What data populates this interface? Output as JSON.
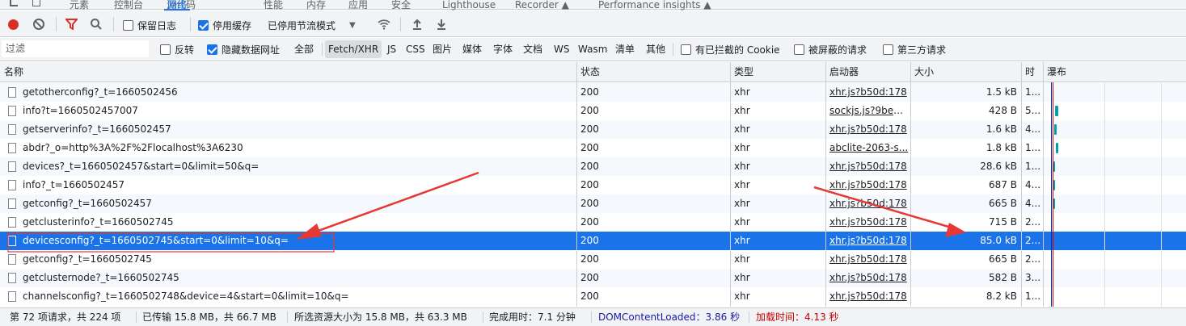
{
  "tabs": [
    "元素",
    "控制台",
    "源代码",
    "网络",
    "性能",
    "内存",
    "应用",
    "安全",
    "Lighthouse",
    "Recorder ▲",
    "Performance insights ▲"
  ],
  "toolbar": {
    "preserve_log": "保留日志",
    "disable_cache": "停用缓存",
    "throttle": "已停用节流模式"
  },
  "filter": {
    "placeholder": "过滤",
    "invert": "反转",
    "hide_data_urls": "隐藏数据网址",
    "all": "全部",
    "types": [
      "Fetch/XHR",
      "JS",
      "CSS",
      "图片",
      "媒体",
      "字体",
      "文档",
      "WS",
      "Wasm",
      "清单",
      "其他"
    ],
    "blocked_cookies": "有已拦截的 Cookie",
    "blocked_requests": "被屏蔽的请求",
    "third_party": "第三方请求"
  },
  "columns": {
    "name": "名称",
    "status": "状态",
    "type": "类型",
    "initiator": "启动器",
    "size": "大小",
    "time": "时",
    "waterfall": "瀑布"
  },
  "rows": [
    {
      "name": "getotherconfig?_t=1660502456",
      "status": "200",
      "type": "xhr",
      "initiator": "xhr.js?b50d:178",
      "size": "1.5 kB",
      "time": "1..."
    },
    {
      "name": "info?t=1660502457007",
      "status": "200",
      "type": "xhr",
      "initiator": "sockjs.js?9be2:...",
      "size": "428 B",
      "time": "5..."
    },
    {
      "name": "getserverinfo?_t=1660502457",
      "status": "200",
      "type": "xhr",
      "initiator": "xhr.js?b50d:178",
      "size": "1.6 kB",
      "time": "4..."
    },
    {
      "name": "abdr?_o=http%3A%2F%2Flocalhost%3A6230",
      "status": "200",
      "type": "xhr",
      "initiator": "abclite-2063-s...",
      "size": "1.8 kB",
      "time": "1..."
    },
    {
      "name": "devices?_t=1660502457&start=0&limit=50&q=",
      "status": "200",
      "type": "xhr",
      "initiator": "xhr.js?b50d:178",
      "size": "28.6 kB",
      "time": "1..."
    },
    {
      "name": "info?_t=1660502457",
      "status": "200",
      "type": "xhr",
      "initiator": "xhr.js?b50d:178",
      "size": "687 B",
      "time": "4..."
    },
    {
      "name": "getconfig?_t=1660502457",
      "status": "200",
      "type": "xhr",
      "initiator": "xhr.js?b50d:178",
      "size": "665 B",
      "time": "4..."
    },
    {
      "name": "getclusterinfo?_t=1660502745",
      "status": "200",
      "type": "xhr",
      "initiator": "xhr.js?b50d:178",
      "size": "715 B",
      "time": "2..."
    },
    {
      "name": "devicesconfig?_t=1660502745&start=0&limit=10&q=",
      "status": "200",
      "type": "xhr",
      "initiator": "xhr.js?b50d:178",
      "size": "85.0 kB",
      "time": "2..."
    },
    {
      "name": "getconfig?_t=1660502745",
      "status": "200",
      "type": "xhr",
      "initiator": "xhr.js?b50d:178",
      "size": "665 B",
      "time": "2..."
    },
    {
      "name": "getclusternode?_t=1660502745",
      "status": "200",
      "type": "xhr",
      "initiator": "xhr.js?b50d:178",
      "size": "582 B",
      "time": "3..."
    },
    {
      "name": "channelsconfig?_t=1660502748&device=4&start=0&limit=10&q=",
      "status": "200",
      "type": "xhr",
      "initiator": "xhr.js?b50d:178",
      "size": "8.2 kB",
      "time": "1..."
    }
  ],
  "statusbar": {
    "requests": "第 72 项请求，共 224 项",
    "transferred": "已传输 15.8 MB，共 66.7 MB",
    "resources": "所选资源大小为 15.8 MB，共 63.3 MB",
    "finish": "完成用时：7.1 分钟",
    "dcl": "DOMContentLoaded：3.86 秒",
    "load": "加载时间：4.13 秒"
  },
  "colors": {
    "accent": "#1a73e8",
    "dcl": "#1a1aa6",
    "load": "#c80000",
    "annotation": "#e53935"
  }
}
